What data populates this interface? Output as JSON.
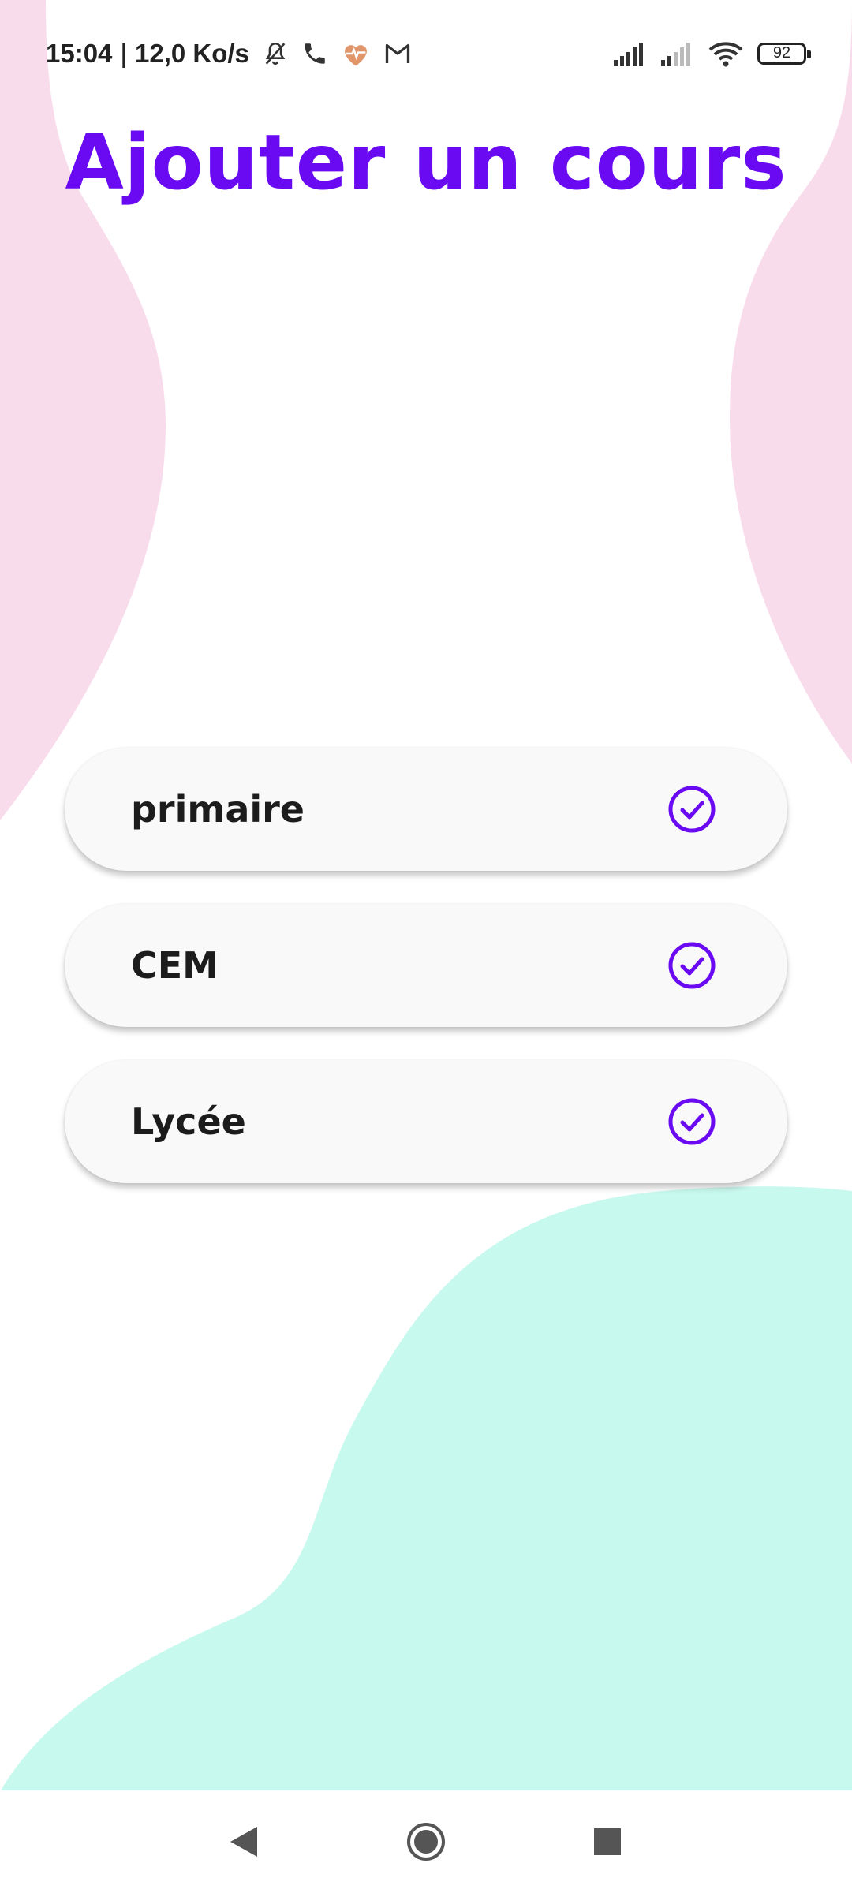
{
  "status_bar": {
    "time": "15:04",
    "separator": "|",
    "data_rate": "12,0 Ko/s",
    "battery_level": "92",
    "left_icons": [
      "bell-muted-icon",
      "phone-icon",
      "health-heart-icon",
      "gmail-icon"
    ],
    "right_icons": [
      "signal-icon",
      "signal-icon",
      "wifi-icon",
      "battery-icon"
    ]
  },
  "page": {
    "title": "Ajouter un cours"
  },
  "options": [
    {
      "label": "primaire",
      "icon": "check-circle-icon"
    },
    {
      "label": "CEM",
      "icon": "check-circle-icon"
    },
    {
      "label": "Lycée",
      "icon": "check-circle-icon"
    }
  ],
  "navigation": {
    "buttons": [
      "back-icon",
      "home-icon",
      "recents-icon"
    ]
  },
  "colors": {
    "accent": "#6a0af2",
    "blob_pink": "#f9dcec",
    "blob_mint": "#c8f9ee",
    "option_bg": "#f9f9f9"
  }
}
